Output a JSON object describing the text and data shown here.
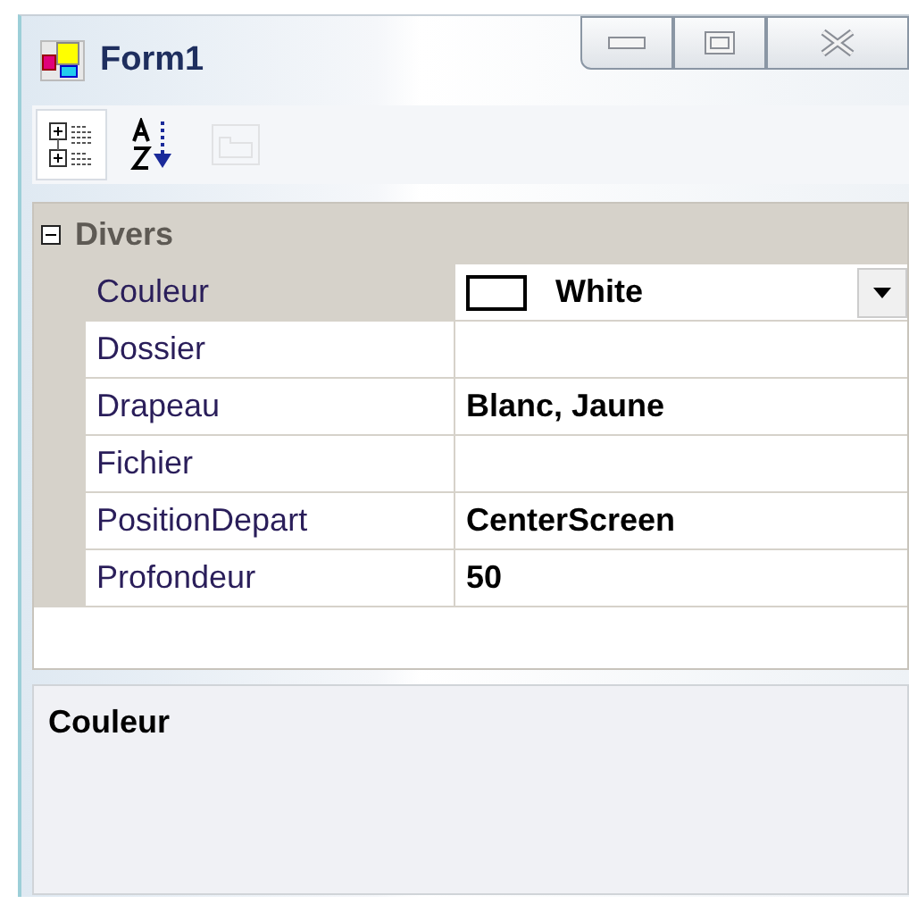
{
  "window": {
    "title": "Form1"
  },
  "toolbar": [
    {
      "kind": "categorized",
      "selected": true,
      "disabled": false
    },
    {
      "kind": "alphabetical",
      "selected": false,
      "disabled": false
    },
    {
      "kind": "pages",
      "selected": false,
      "disabled": true
    }
  ],
  "grid": {
    "category": {
      "label": "Divers",
      "expanded": true
    },
    "rows": [
      {
        "name": "Couleur",
        "value": "White",
        "selected": true,
        "kind": "color"
      },
      {
        "name": "Dossier",
        "selected": false,
        "kind": "text"
      },
      {
        "name": "Drapeau",
        "value": "Blanc, Jaune",
        "selected": false,
        "kind": "text"
      },
      {
        "name": "Fichier",
        "selected": false,
        "kind": "text"
      },
      {
        "name": "PositionDepart",
        "value": "CenterScreen",
        "selected": false,
        "kind": "text"
      },
      {
        "name": "Profondeur",
        "value": "50",
        "selected": false,
        "kind": "text"
      }
    ]
  },
  "description": {
    "title": "Couleur"
  }
}
